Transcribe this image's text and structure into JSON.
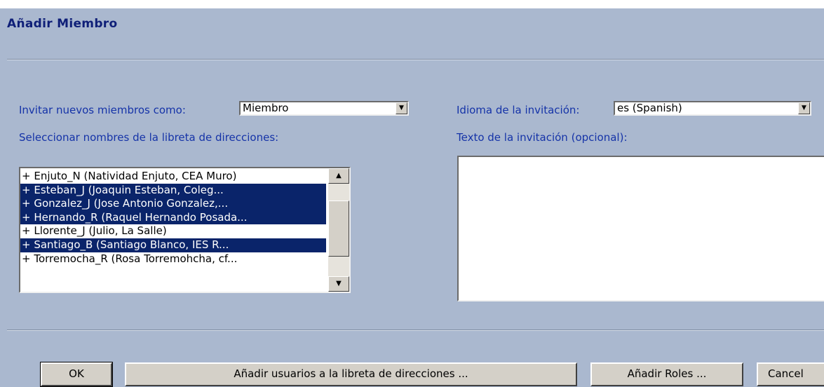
{
  "dialog": {
    "title": "Añadir Miembro"
  },
  "invite": {
    "label": "Invitar nuevos miembros como:",
    "role_value": "Miembro"
  },
  "language": {
    "label": "Idioma de la invitación:",
    "value": "es (Spanish)"
  },
  "addressbook": {
    "label": "Seleccionar nombres de la libreta de direcciones:",
    "items": [
      {
        "text": "+ Enjuto_N (Natividad Enjuto, CEA Muro)",
        "selected": false
      },
      {
        "text": "+ Esteban_J (Joaquin Esteban, Coleg...",
        "selected": true
      },
      {
        "text": "+ Gonzalez_J (Jose Antonio Gonzalez,...",
        "selected": true
      },
      {
        "text": "+ Hernando_R (Raquel Hernando Posada...",
        "selected": true
      },
      {
        "text": "+ Llorente_J (Julio, La Salle)",
        "selected": false
      },
      {
        "text": "+ Santiago_B (Santiago Blanco, IES R...",
        "selected": true
      },
      {
        "text": "+ Torremocha_R (Rosa Torremohcha, cf...",
        "selected": false
      }
    ]
  },
  "invitation_text": {
    "label": "Texto de la invitación (opcional):",
    "value": ""
  },
  "buttons": {
    "ok": "OK",
    "add_users": "Añadir usuarios a la libreta de direcciones ...",
    "add_roles": "Añadir Roles ...",
    "cancel": "Cancel"
  },
  "icons": {
    "dropdown": "chevron-down-icon",
    "scroll_up": "arrow-up-icon",
    "scroll_down": "arrow-down-icon"
  }
}
